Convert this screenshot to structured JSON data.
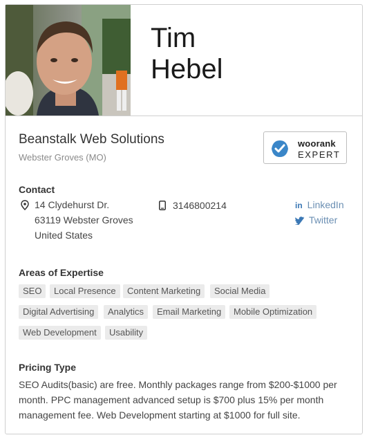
{
  "profile": {
    "first_name": "Tim",
    "last_name": "Hebel",
    "company": "Beanstalk Web Solutions",
    "location": "Webster Groves (MO)"
  },
  "badge": {
    "line1": "woorank",
    "line2": "EXPERT",
    "accent": "#3a86c8"
  },
  "contact": {
    "title": "Contact",
    "address_lines": [
      "14 Clydehurst Dr.",
      "63119 Webster Groves",
      "United States"
    ],
    "phone": "3146800214",
    "linkedin": "LinkedIn",
    "twitter": "Twitter",
    "icons": [
      "location-pin-icon",
      "mobile-phone-icon",
      "linkedin-icon",
      "twitter-icon"
    ]
  },
  "expertise": {
    "title": "Areas of Expertise",
    "tags": [
      "SEO",
      "Local Presence",
      "Content Marketing",
      "Social Media",
      "Digital Advertising",
      "Analytics",
      "Email Marketing",
      "Mobile Optimization",
      "Web Development",
      "Usability"
    ]
  },
  "pricing": {
    "title": "Pricing Type",
    "text": "SEO Audits(basic) are free. Monthly packages range from $200-$1000 per month. PPC management advanced setup is $700 plus 15% per month management fee. Web Development starting at $1000 for full site."
  }
}
